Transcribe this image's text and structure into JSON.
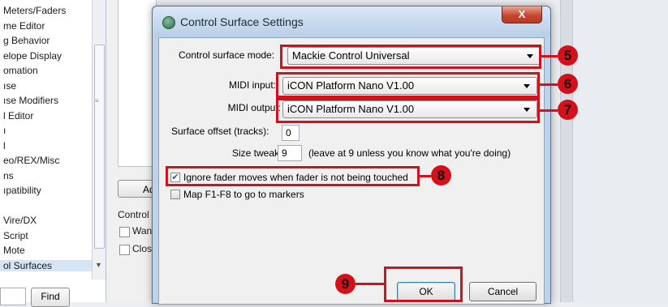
{
  "background_window": {
    "sidebar_items": [
      {
        "label": "Meters/Faders",
        "selected": false
      },
      {
        "label": "me Editor",
        "selected": false
      },
      {
        "label": "g Behavior",
        "selected": false
      },
      {
        "label": "elope Display",
        "selected": false
      },
      {
        "label": "omation",
        "selected": false
      },
      {
        "label": "ıse",
        "selected": false
      },
      {
        "label": "ıse Modifiers",
        "selected": false
      },
      {
        "label": "l Editor",
        "selected": false
      },
      {
        "label": "ı",
        "selected": false
      },
      {
        "label": "l",
        "selected": false
      },
      {
        "label": "eo/REX/Misc",
        "selected": false
      },
      {
        "label": "ns",
        "selected": false
      },
      {
        "label": "ıpatibility",
        "selected": false
      },
      {
        "label": "",
        "selected": false
      },
      {
        "label": "Vire/DX",
        "selected": false
      },
      {
        "label": "Script",
        "selected": false
      },
      {
        "label": "Mote",
        "selected": false
      },
      {
        "label": "ol Surfaces",
        "selected": true
      }
    ],
    "add_button_label": "Ad",
    "control_label": "Control s",
    "warn_checkbox_label": "Wan",
    "close_checkbox_label": "Clos",
    "find_button_label": "Find"
  },
  "dialog": {
    "title": "Control Surface Settings",
    "close_glyph": "X",
    "mode_label": "Control surface mode:",
    "mode_value": "Mackie Control  Universal",
    "midi_input_label": "MIDI input:",
    "midi_input_value": "iCON Platform Nano V1.00",
    "midi_output_label": "MIDI output:",
    "midi_output_value": "iCON Platform Nano V1.00",
    "surface_offset_label": "Surface offset (tracks):",
    "surface_offset_value": "0",
    "size_tweak_label": "Size tweak:",
    "size_tweak_value": "9",
    "size_tweak_hint": "(leave at 9 unless you know what you're doing)",
    "ignore_fader_label": "Ignore fader moves when fader is not being touched",
    "ignore_fader_checked": true,
    "map_f1_f8_label": "Map F1-F8 to go to markers",
    "map_f1_f8_checked": false,
    "ok_label": "OK",
    "cancel_label": "Cancel"
  },
  "callouts": [
    "5",
    "6",
    "7",
    "8",
    "9"
  ],
  "accent_color": "#d4101a"
}
